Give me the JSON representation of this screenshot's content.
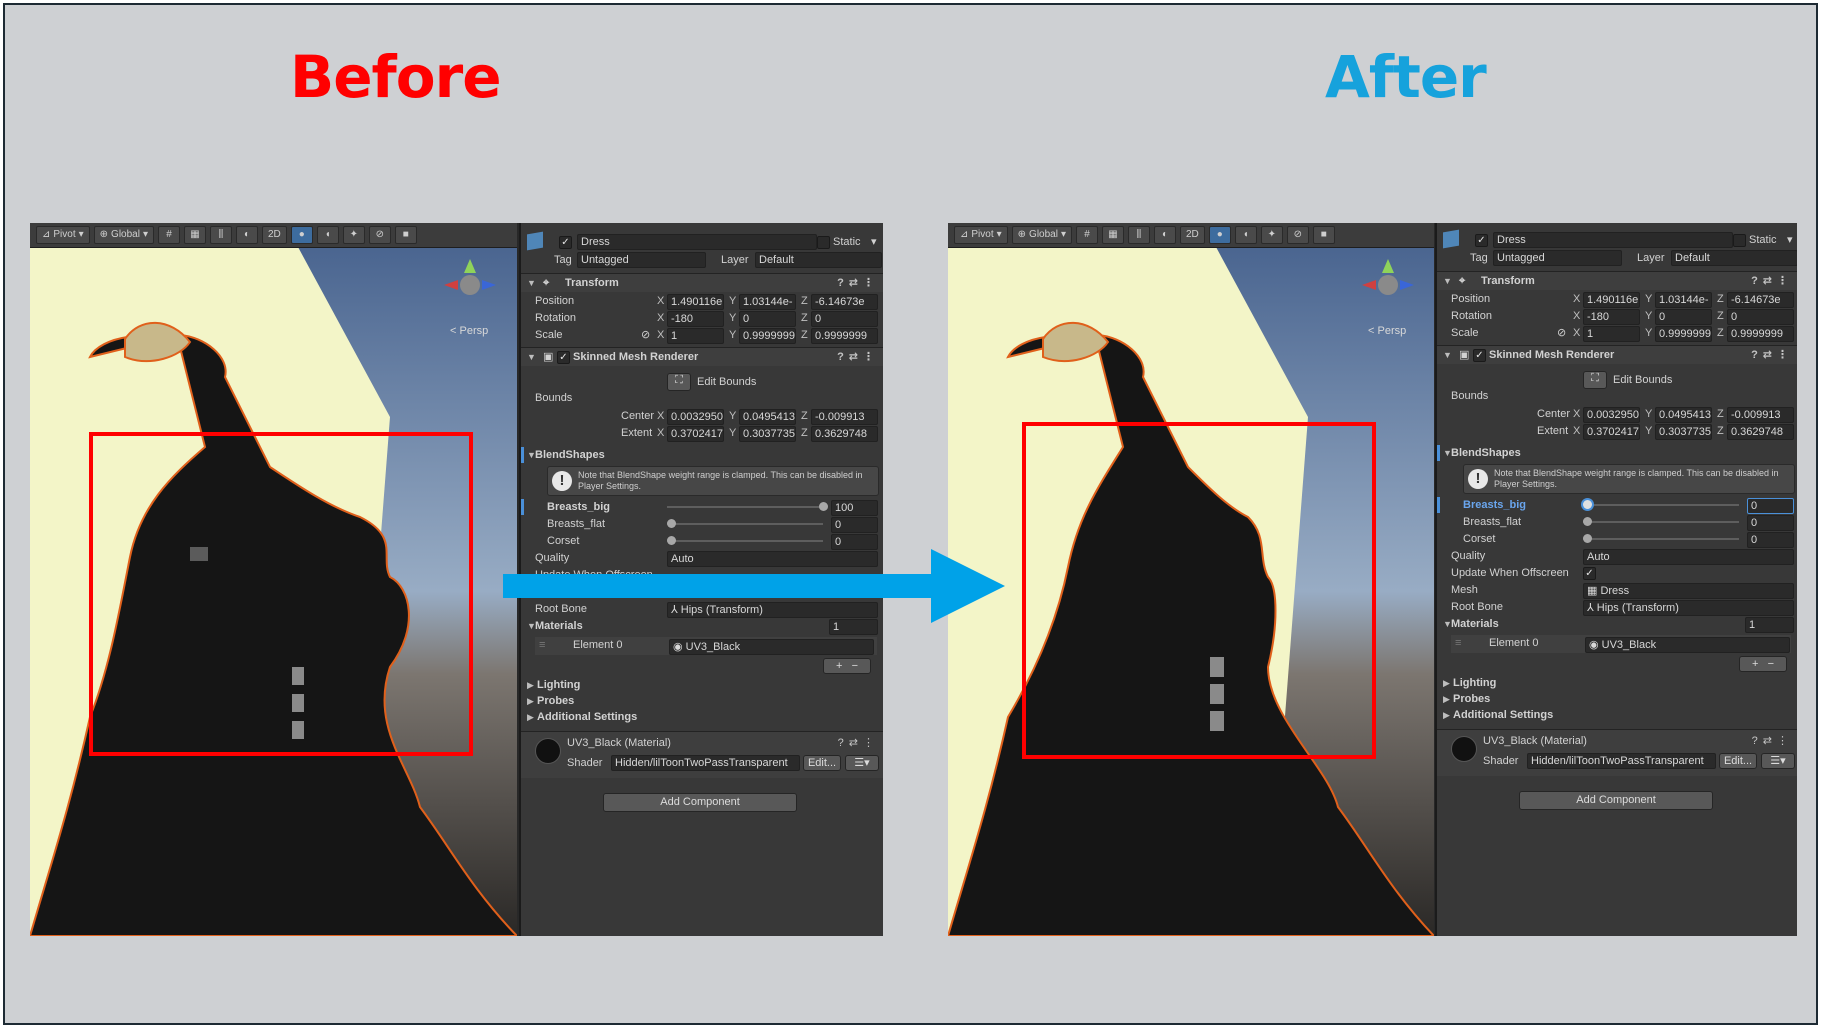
{
  "titles": {
    "before": "Before",
    "after": "After",
    "before_color": "#ff0000",
    "after_color": "#16a2dc"
  },
  "highlight_color": "#ff0000",
  "arrow_color": "#00a2e8",
  "toolbar": {
    "pivot": "Pivot",
    "global": "Global",
    "two_d": "2D",
    "persp": "Persp"
  },
  "inspector": {
    "object_name": "Dress",
    "static_label": "Static",
    "tag_label": "Tag",
    "tag_value": "Untagged",
    "layer_label": "Layer",
    "layer_value": "Default",
    "transform": {
      "title": "Transform",
      "position_label": "Position",
      "rotation_label": "Rotation",
      "scale_label": "Scale",
      "position": [
        "1.490116e",
        "1.03144e-",
        "-6.14673e"
      ],
      "rotation": [
        "-180",
        "0",
        "0"
      ],
      "scale": [
        "1",
        "0.9999999",
        "0.9999999"
      ]
    },
    "axes": [
      "X",
      "Y",
      "Z"
    ],
    "smr": {
      "title": "Skinned Mesh Renderer",
      "edit_bounds": "Edit Bounds",
      "bounds_label": "Bounds",
      "center_label": "Center",
      "extent_label": "Extent",
      "center": [
        "0.0032950",
        "0.0495413",
        "-0.009913"
      ],
      "extent": [
        "0.3702417",
        "0.3037735",
        "0.3629748"
      ],
      "blendshapes_label": "BlendShapes",
      "note": "Note that BlendShape weight range is clamped. This can be disabled in Player Settings.",
      "quality_label": "Quality",
      "quality_value": "Auto",
      "update_offscreen_label": "Update When Offscreen",
      "mesh_label": "Mesh",
      "mesh_value": "Dress",
      "root_bone_label": "Root Bone",
      "root_bone_value": "Hips (Transform)",
      "materials_label": "Materials",
      "materials_count": "1",
      "element0_label": "Element 0",
      "element0_value": "UV3_Black",
      "plus": "+",
      "minus": "−"
    },
    "sections": [
      "Lighting",
      "Probes",
      "Additional Settings"
    ],
    "material": {
      "title": "UV3_Black (Material)",
      "shader_label": "Shader",
      "shader_value": "Hidden/lilToonTwoPassTransparent",
      "edit": "Edit..."
    },
    "add_component": "Add Component"
  },
  "blendshapes_before": [
    {
      "name": "Breasts_big",
      "value": "100",
      "level": 1.0
    },
    {
      "name": "Breasts_flat",
      "value": "0",
      "level": 0
    },
    {
      "name": "Corset",
      "value": "0",
      "level": 0
    }
  ],
  "blendshapes_after": [
    {
      "name": "Breasts_big",
      "value": "0",
      "level": 0
    },
    {
      "name": "Breasts_flat",
      "value": "0",
      "level": 0
    },
    {
      "name": "Corset",
      "value": "0",
      "level": 0
    }
  ]
}
